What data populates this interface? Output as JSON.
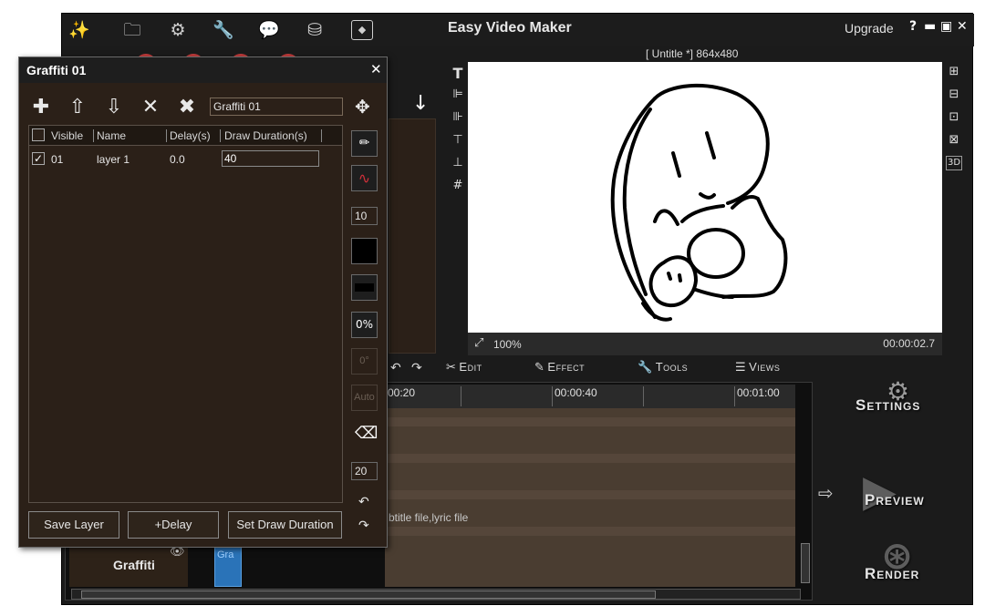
{
  "app": {
    "title": "Easy Video Maker",
    "upgrade": "Upgrade",
    "help": "?",
    "minimize": "▬",
    "maximize": "▣",
    "close": "✕"
  },
  "toolbar_icons": [
    "wand-icon",
    "folder-icon",
    "gear-icon",
    "wrench-icon",
    "chat-icon",
    "database-icon",
    "palette-icon"
  ],
  "canvas": {
    "title": "[ Untitle *]  864x480",
    "zoom": "100%",
    "time": "00:00:02.7"
  },
  "left_tools": [
    "T",
    "⊫",
    "⊪",
    "⊤",
    "⊥",
    "#"
  ],
  "right_tools": [
    "⊞",
    "⊟",
    "⊡",
    "⊠",
    "3D"
  ],
  "menu": {
    "edit": "Edit",
    "effect": "Effect",
    "tools": "Tools",
    "views": "Views"
  },
  "timeline": {
    "ticks": [
      "00:20",
      "00:00:40",
      "00:01:00"
    ],
    "subtitle_hint": "btitle file,lyric file",
    "track_label": "Graffiti",
    "clip_text": "Gra"
  },
  "big_buttons": {
    "settings": "Settings",
    "preview": "Preview",
    "render": "Render"
  },
  "dialog": {
    "title": "Graffiti 01",
    "close": "✕",
    "name_value": "Graffiti 01",
    "columns": [
      "Visible",
      "Name",
      "Delay(s)",
      "Draw Duration(s)"
    ],
    "rows": [
      {
        "visible": "01",
        "name": "layer 1",
        "delay": "0.0",
        "duration": "40"
      }
    ],
    "brush_size": "10",
    "opacity": "0%",
    "angle": "0°",
    "auto": "Auto",
    "eraser_size": "20",
    "buttons": {
      "save_layer": "Save Layer",
      "add_delay": "+Delay",
      "set_duration": "Set Draw Duration"
    }
  },
  "colors": {
    "accent_red": "#c23b3b",
    "timeline_brown": "#4a3d31",
    "dialog_bg": "#2b2018"
  }
}
